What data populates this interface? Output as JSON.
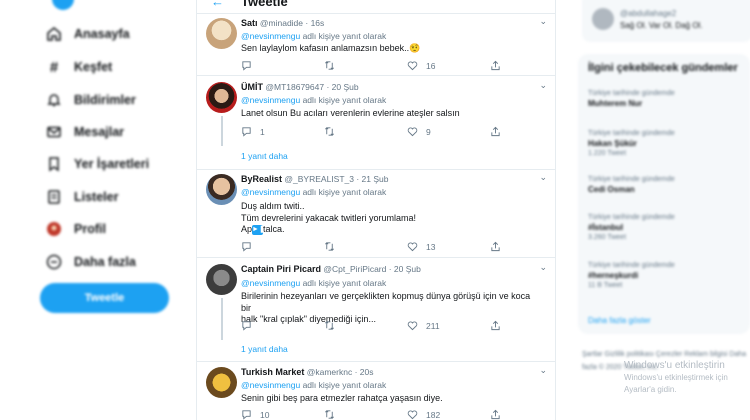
{
  "sidebar": {
    "items": [
      {
        "label": "Anasayfa",
        "icon": "home-icon"
      },
      {
        "label": "Keşfet",
        "icon": "hashtag-icon"
      },
      {
        "label": "Bildirimler",
        "icon": "bell-icon"
      },
      {
        "label": "Mesajlar",
        "icon": "mail-icon"
      },
      {
        "label": "Yer İşaretleri",
        "icon": "bookmark-icon"
      },
      {
        "label": "Listeler",
        "icon": "list-icon"
      },
      {
        "label": "Profil",
        "icon": "profile-icon"
      },
      {
        "label": "Daha fazla",
        "icon": "more-icon"
      }
    ],
    "tweet_button": "Tweetle"
  },
  "header": {
    "title": "Tweetle"
  },
  "tweets": [
    {
      "name": "Satı",
      "handle": "@minadide",
      "time": "16s",
      "reply_prefix": "",
      "reply_to": "@nevsinmengu",
      "reply_suffix": "adlı kişiye yanıt olarak",
      "text": "Sen laylaylom kafasın anlamazsın bebek..",
      "emoji": "🤨",
      "replies": "",
      "retweets": "",
      "likes": "16"
    },
    {
      "name": "ÜMİT",
      "handle": "@MT18679647",
      "time": "20 Şub",
      "reply_to": "@nevsinmengu",
      "reply_suffix": "adlı kişiye yanıt olarak",
      "text": "Lanet olsun Bu acıları verenlerin evlerine ateşler salsın",
      "replies": "1",
      "retweets": "",
      "likes": "9",
      "thread_more": "1 yanıt daha"
    },
    {
      "name": "ByRealist",
      "handle": "@_BYREALIST_3",
      "time": "21 Şub",
      "reply_to": "@nevsinmengu",
      "reply_suffix": "adlı kişiye yanıt olarak",
      "lines": [
        "Duş aldım twiti..",
        "Tüm devrelerini yakacak twitleri yorumlama!",
        "Ap",
        "talca."
      ],
      "replies": "",
      "retweets": "",
      "likes": "13"
    },
    {
      "name": "Captain Piri Picard",
      "handle": "@Cpt_PiriPicard",
      "time": "20 Şub",
      "reply_to": "@nevsinmengu",
      "reply_suffix": "adlı kişiye yanıt olarak",
      "lines": [
        "Birilerinin hezeyanları ve gerçeklikten kopmuş dünya görüşü için ve koca bir",
        "halk \"kral çıplak\" diyemediği için..."
      ],
      "replies": "",
      "retweets": "",
      "likes": "211",
      "thread_more": "1 yanıt daha"
    },
    {
      "name": "Turkish Market",
      "handle": "@kamerknc",
      "time": "20s",
      "reply_to": "@nevsinmengu",
      "reply_suffix": "adlı kişiye yanıt olarak",
      "text": "Senin gibi beş para etmezler rahatça yaşasın diye.",
      "replies": "10",
      "retweets": "",
      "likes": "182"
    }
  ],
  "right": {
    "profile_handle": "@abdullahage2",
    "profile_bio": "Sağ Ol. Var Ol. Dağ Ol.",
    "trends_title": "İlgini çekebilecek gündemler",
    "trends": [
      {
        "context": "Türkiye tarihinde gündemde",
        "name": "Muhterem Nur",
        "count": ""
      },
      {
        "context": "Türkiye tarihinde gündemde",
        "name": "Hakan Şükür",
        "count": "1.220 Tweet"
      },
      {
        "context": "Türkiye tarihinde gündemde",
        "name": "Cedi Osman",
        "count": ""
      },
      {
        "context": "Türkiye tarihinde gündemde",
        "name": "#İstanbul",
        "count": "3.260 Tweet"
      },
      {
        "context": "Türkiye tarihinde gündemde",
        "name": "#herneşkurdi",
        "count": "11 B Tweet"
      }
    ],
    "show_more": "Daha fazla göster",
    "footer": "Şartlar   Gizlilik politikası   Çerezler   Reklam bilgisi   Daha fazla   © 2020 Twitter, Inc.",
    "watermark_line1": "Windows'u etkinleştirin",
    "watermark_line2": "Windows'u etkinleştirmek için",
    "watermark_line3": "Ayarlar'a gidin."
  }
}
